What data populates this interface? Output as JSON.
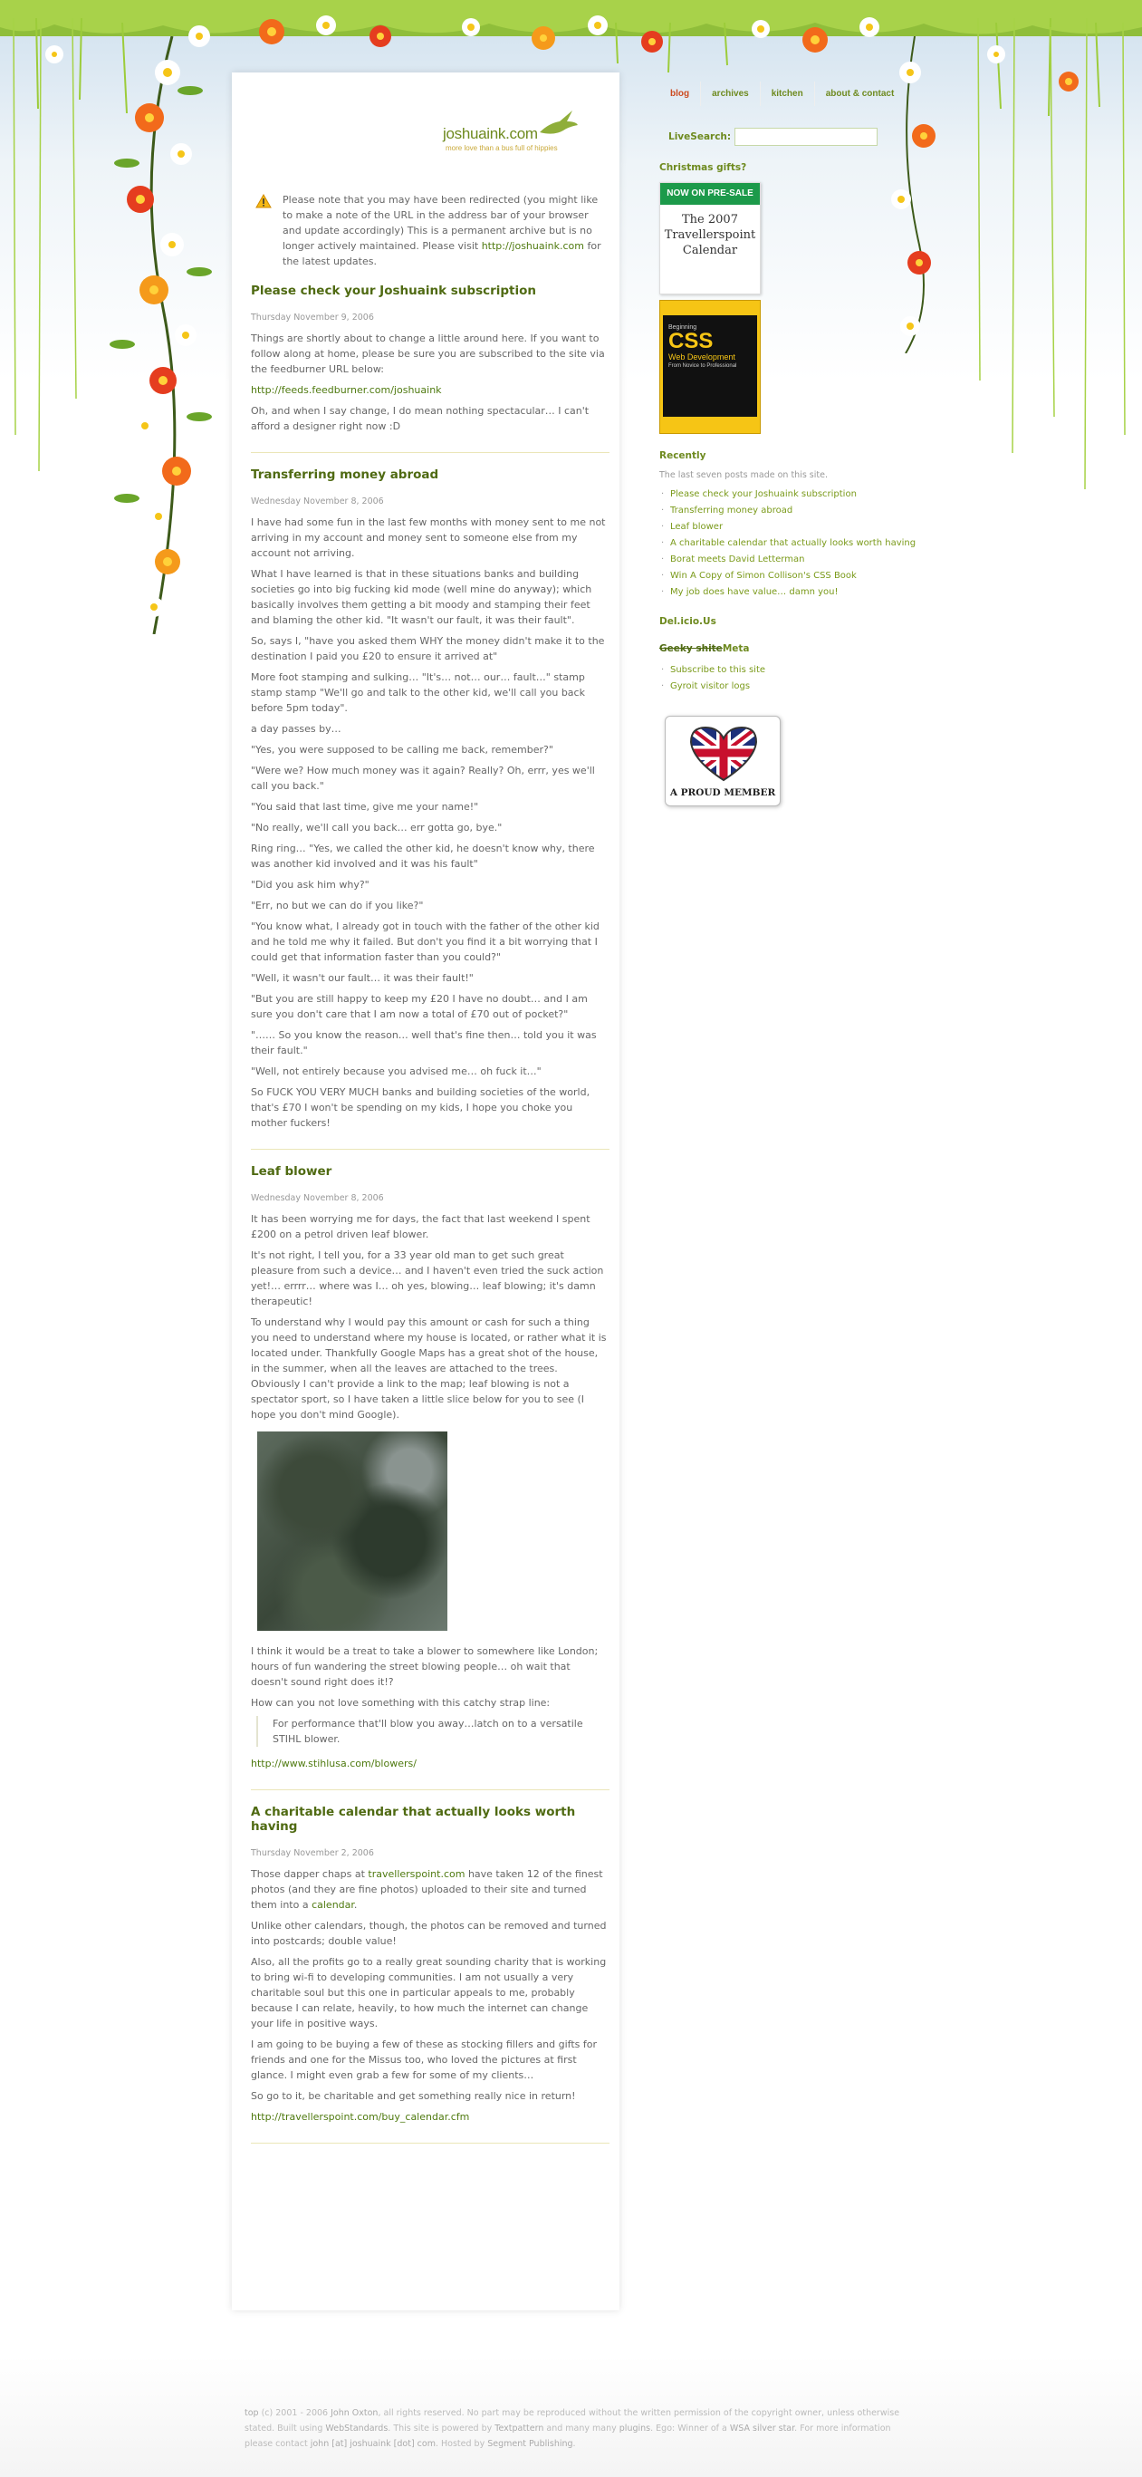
{
  "site": {
    "logo": "joshuaink.com",
    "tagline": "more love than a bus full of hippies"
  },
  "nav": [
    {
      "label": "blog"
    },
    {
      "label": "archives"
    },
    {
      "label": "kitchen"
    },
    {
      "label": "about & contact"
    }
  ],
  "search": {
    "label": "LiveSearch:",
    "value": ""
  },
  "notice": {
    "text": "Please note that you may have been redirected (you might like to make a note of the URL in the address bar of your browser and update accordingly) This is a permanent archive but is no longer actively maintained. Please visit ",
    "link": "http://joshuaink.com",
    "tail": " for the latest updates."
  },
  "posts": [
    {
      "title": "Please check your Joshuaink subscription",
      "date": "Thursday November 9, 2006",
      "p1": "Things are shortly about to change a little around here. If you want to follow along at home, please be sure you are subscribed to the site via the feedburner URL below:",
      "link": "http://feeds.feedburner.com/joshuaink",
      "p2": "Oh, and when I say change, I do mean nothing spectacular… I can't afford a designer right now :D"
    },
    {
      "title": "Transferring money abroad",
      "date": "Wednesday November 8, 2006",
      "paras": [
        "I have had some fun in the last few months with money sent to me not arriving in my account and money sent to someone else from my account not arriving.",
        "What I have learned is that in these situations banks and building societies go into big fucking kid mode (well mine do anyway); which basically involves them getting a bit moody and stamping their feet and blaming the other kid. \"It wasn't our fault, it was their fault\".",
        "So, says I, \"have you asked them WHY the money didn't make it to the destination I paid you £20 to ensure it arrived at\"",
        "More foot stamping and sulking… \"It's… not… our… fault…\" stamp stamp stamp \"We'll go and talk to the other kid, we'll call you back before 5pm today\".",
        "a day passes by…",
        "\"Yes, you were supposed to be calling me back, remember?\"",
        "\"Were we? How much money was it again? Really? Oh, errr, yes we'll call you back.\"",
        "\"You said that last time, give me your name!\"",
        "\"No really, we'll call you back… err gotta go, bye.\"",
        "Ring ring… \"Yes, we called the other kid, he doesn't know why, there was another kid involved and it was his fault\"",
        "\"Did you ask him why?\"",
        "\"Err, no but we can do if you like?\"",
        "\"You know what, I already got in touch with the father of the other kid and he told me why it failed. But don't you find it a bit worrying that I could get that information faster than you could?\"",
        "\"Well, it wasn't our fault… it was their fault!\"",
        "\"But you are still happy to keep my £20 I have no doubt… and I am sure you don't care that I am now a total of £70 out of pocket?\"",
        "\"…… So you know the reason… well that's fine then… told you it was their fault.\"",
        "\"Well, not entirely because you advised me… oh fuck it…\"",
        "So FUCK YOU VERY MUCH banks and building societies of the world, that's £70 I won't be spending on my kids, I hope you choke you mother fuckers!"
      ]
    },
    {
      "title": "Leaf blower",
      "date": "Wednesday November 8, 2006",
      "paras": [
        "It has been worrying me for days, the fact that last weekend I spent £200 on a petrol driven leaf blower.",
        "It's not right, I tell you, for a 33 year old man to get such great pleasure from such a device… and I haven't even tried the suck action yet!… errrr… where was I… oh yes, blowing… leaf blowing; it's damn therapeutic!",
        "To understand why I would pay this amount or cash for such a thing you need to understand where my house is located, or rather what it is located under. Thankfully Google Maps has a great shot of the house, in the summer, when all the leaves are attached to the trees. Obviously I can't provide a link to the map; leaf blowing is not a spectator sport, so I have taken a little slice below for you to see (I hope you don't mind Google)."
      ],
      "after": [
        "I think it would be a treat to take a blower to somewhere like London; hours of fun wandering the street blowing people… oh wait that doesn't sound right does it!?",
        "How can you not love something with this catchy strap line:"
      ],
      "quote": "For performance that'll blow you away…latch on to a versatile STIHL blower.",
      "link": "http://www.stihlusa.com/blowers/"
    },
    {
      "title": "A charitable calendar that actually looks worth having",
      "date": "Thursday November 2, 2006",
      "p1a": "Those dapper chaps at ",
      "p1link": "travellerspoint.com",
      "p1b": " have taken 12 of the finest photos (and they are fine photos) uploaded to their site and turned them into a ",
      "p1link2": "calendar",
      "p1c": ".",
      "paras": [
        "Unlike other calendars, though, the photos can be removed and turned into postcards; double value!",
        "Also, all the profits go to a really great sounding charity that is working to bring wi-fi to developing communities. I am not usually a very charitable soul but this one in particular appeals to me, probably because I can relate, heavily, to how much the internet can change your life in positive ways.",
        "I am going to be buying a few of these as stocking fillers and gifts for friends and one for the Missus too, who loved the pictures at first glance. I might even grab a few for some of my clients…",
        "So go to it, be charitable and get something really nice in return!"
      ],
      "link": "http://travellerspoint.com/buy_calendar.cfm"
    }
  ],
  "sidebar": {
    "xmas_heading": "Christmas gifts?",
    "calendar": {
      "top": "NOW ON PRE-SALE",
      "line1": "The 2007",
      "line2": "Travellerspoint",
      "line3": "Calendar"
    },
    "book": {
      "small": "Beginning",
      "big": "CSS",
      "sub": "Web Development",
      "tag": "From Novice to Professional"
    },
    "recently_heading": "Recently",
    "recently_desc": "The last seven posts made on this site.",
    "recent": [
      "Please check your Joshuaink subscription",
      "Transferring money abroad",
      "Leaf blower",
      "A charitable calendar that actually looks worth having",
      "Borat meets David Letterman",
      "Win A Copy of Simon Collison's CSS Book",
      "My job does have value… damn you!"
    ],
    "delicious_heading": "Del.icio.Us",
    "geeky": "Geeky shite",
    "meta": "Meta",
    "meta_links": [
      "Subscribe to this site",
      "Gyroit visitor logs"
    ],
    "badge_text": "A PROUD MEMBER"
  },
  "footer": {
    "top": "top",
    "copy": " (c) 2001 - 2006 ",
    "author": "John Oxton",
    "t1": ", all rights reserved. No part may be reproduced without the written permission of the copyright owner, unless otherwise stated. Built using ",
    "webstandards": "WebStandards",
    "t2": ". This site is powered by ",
    "textpattern": "Textpattern",
    "t3": " and many many ",
    "plugins": "plugins",
    "t4": ". Ego: Winner of a ",
    "wsa": "WSA silver star",
    "t5": ". For more information please contact ",
    "email": "john [at] joshuaink [dot] com",
    "t6": ". Hosted by ",
    "host": "Segment Publishing",
    "t7": "."
  },
  "colors": {
    "accent": "#6e8a1f",
    "link": "#4f7a10",
    "nav_active": "#cc4a1f",
    "calendar_green": "#1c9a4a",
    "book_yellow": "#f6c515"
  }
}
